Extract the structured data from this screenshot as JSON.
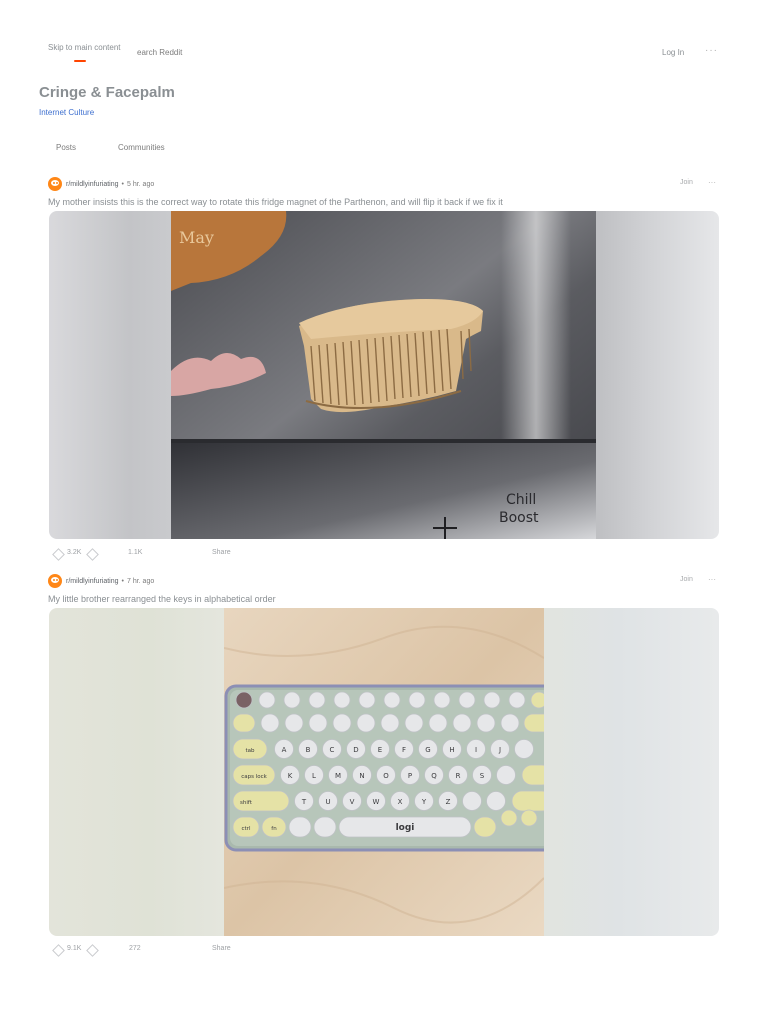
{
  "header": {
    "skip_link": "Skip to main content",
    "search_text": "earch Reddit",
    "login_label": "Log In",
    "more_label": "···"
  },
  "community": {
    "title": "Cringe & Facepalm",
    "topic": "Internet Culture"
  },
  "tabs": [
    {
      "label": "Posts"
    },
    {
      "label": "Communities"
    }
  ],
  "posts": [
    {
      "subreddit": "r/mildlyinfuriating",
      "dot": "•",
      "time": "5 hr. ago",
      "join_label": "Join",
      "more_label": "···",
      "title": "My mother insists this is the correct way to rotate this fridge magnet of the Parthenon, and will flip it back if we fix it",
      "image_text": [
        "Chill",
        "Boost",
        "May"
      ],
      "votes": "3.2K",
      "comments": "1.1K",
      "share_label": "Share"
    },
    {
      "subreddit": "r/mildlyinfuriating",
      "dot": "•",
      "time": "7 hr. ago",
      "join_label": "Join",
      "more_label": "···",
      "title": "My little brother rearranged the keys in alphabetical order",
      "keyboard": {
        "brand": "logi",
        "row_labels": [
          "tab",
          "caps lock",
          "shift",
          "ctrl",
          "fn"
        ],
        "letters_row1": [
          "A",
          "B",
          "C",
          "D",
          "E",
          "F",
          "G",
          "H",
          "I",
          "J"
        ],
        "letters_row2": [
          "K",
          "L",
          "M",
          "N",
          "O",
          "P",
          "Q",
          "R",
          "S"
        ],
        "letters_row3": [
          "T",
          "U",
          "V",
          "W",
          "X",
          "Y",
          "Z"
        ]
      },
      "votes": "9.1K",
      "comments": "272",
      "share_label": "Share"
    }
  ],
  "colors": {
    "accent": "#ff4500",
    "link": "#3d6fcf",
    "avatar": "#ff8717"
  }
}
